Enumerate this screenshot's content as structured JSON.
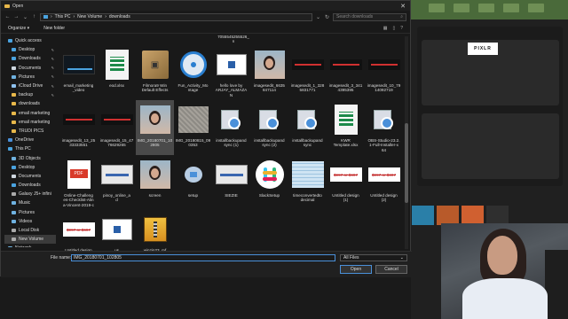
{
  "window": {
    "title": "Open"
  },
  "address": {
    "path": [
      "This PC",
      "New Volume",
      "downloads"
    ],
    "search_placeholder": "Search downloads"
  },
  "toolbar": {
    "organize": "Organize ▾",
    "new_folder": "New folder"
  },
  "sidebar": {
    "items": [
      {
        "label": "Quick access",
        "icon": "star-icon",
        "color": "#4aa3e0",
        "sub": false,
        "pin": false,
        "sel": false
      },
      {
        "label": "Desktop",
        "icon": "desktop-icon",
        "color": "#4aa3e0",
        "sub": true,
        "pin": true,
        "sel": false
      },
      {
        "label": "Downloads",
        "icon": "downloads-icon",
        "color": "#4aa3e0",
        "sub": true,
        "pin": true,
        "sel": false
      },
      {
        "label": "Documents",
        "icon": "documents-icon",
        "color": "#cfd8e0",
        "sub": true,
        "pin": true,
        "sel": false
      },
      {
        "label": "Pictures",
        "icon": "pictures-icon",
        "color": "#6fb2e0",
        "sub": true,
        "pin": true,
        "sel": false
      },
      {
        "label": "iCloud Drive",
        "icon": "cloud-icon",
        "color": "#8fc2f0",
        "sub": true,
        "pin": true,
        "sel": false
      },
      {
        "label": "backup",
        "icon": "folder-icon",
        "color": "#e8b84a",
        "sub": true,
        "pin": true,
        "sel": false
      },
      {
        "label": "downloads",
        "icon": "folder-icon",
        "color": "#e8b84a",
        "sub": true,
        "pin": false,
        "sel": false
      },
      {
        "label": "email marketing",
        "icon": "folder-icon",
        "color": "#e8b84a",
        "sub": true,
        "pin": false,
        "sel": false
      },
      {
        "label": "email marketing",
        "icon": "folder-icon",
        "color": "#e8b84a",
        "sub": true,
        "pin": false,
        "sel": false
      },
      {
        "label": "TRUDI PICS",
        "icon": "folder-icon",
        "color": "#e8b84a",
        "sub": true,
        "pin": false,
        "sel": false
      },
      {
        "label": "OneDrive",
        "icon": "onedrive-icon",
        "color": "#4a90d9",
        "sub": false,
        "pin": false,
        "sel": false
      },
      {
        "label": "This PC",
        "icon": "computer-icon",
        "color": "#4aa3e0",
        "sub": false,
        "pin": false,
        "sel": false
      },
      {
        "label": "3D Objects",
        "icon": "cube-icon",
        "color": "#6fb2e0",
        "sub": true,
        "pin": false,
        "sel": false
      },
      {
        "label": "Desktop",
        "icon": "desktop-icon",
        "color": "#4aa3e0",
        "sub": true,
        "pin": false,
        "sel": false
      },
      {
        "label": "Documents",
        "icon": "documents-icon",
        "color": "#cfd8e0",
        "sub": true,
        "pin": false,
        "sel": false
      },
      {
        "label": "Downloads",
        "icon": "downloads-icon",
        "color": "#4aa3e0",
        "sub": true,
        "pin": false,
        "sel": false
      },
      {
        "label": "Galaxy J5+ infini",
        "icon": "phone-icon",
        "color": "#aaaaaa",
        "sub": true,
        "pin": false,
        "sel": false
      },
      {
        "label": "Music",
        "icon": "music-icon",
        "color": "#6fb2e0",
        "sub": true,
        "pin": false,
        "sel": false
      },
      {
        "label": "Pictures",
        "icon": "pictures-icon",
        "color": "#6fb2e0",
        "sub": true,
        "pin": false,
        "sel": false
      },
      {
        "label": "Videos",
        "icon": "videos-icon",
        "color": "#6fb2e0",
        "sub": true,
        "pin": false,
        "sel": false
      },
      {
        "label": "Local Disk",
        "icon": "drive-icon",
        "color": "#aaaaaa",
        "sub": true,
        "pin": false,
        "sel": false
      },
      {
        "label": "New Volume",
        "icon": "drive-icon",
        "color": "#aaaaaa",
        "sub": true,
        "pin": false,
        "sel": true
      },
      {
        "label": "Network",
        "icon": "network-icon",
        "color": "#6fb2e0",
        "sub": false,
        "pin": false,
        "sel": false
      }
    ]
  },
  "top_fragment": "7055545255526_\nn",
  "files": [
    {
      "label": "email_marketing\n_video",
      "kind": "video",
      "sel": false
    },
    {
      "label": "eod.xlsx",
      "kind": "sheet",
      "sel": false
    },
    {
      "label": "Filmora9 Win\nDefault Effects",
      "kind": "box",
      "sel": false
    },
    {
      "label": "Fun_Activity_Mo\nntage",
      "kind": "disc",
      "sel": false
    },
    {
      "label": "hello love by\nARJAY_ALMAZA\nN",
      "kind": "doc",
      "sel": false
    },
    {
      "label": "imagesedit_6635\n847114",
      "kind": "photo",
      "sel": false
    },
    {
      "label": "imagesedit_1_328\n5831771",
      "kind": "red",
      "sel": false
    },
    {
      "label": "imagesedit_3_341\n4395395",
      "kind": "red",
      "sel": false
    },
    {
      "label": "imagesedit_10_79\n14092719",
      "kind": "red",
      "sel": false
    },
    {
      "label": "imagesedit_13_25\n33333551",
      "kind": "red",
      "sel": false
    },
    {
      "label": "imagesedit_15_47\n76629265",
      "kind": "red",
      "sel": false
    },
    {
      "label": "IMG_20180701_10\n2805",
      "kind": "photo",
      "sel": true
    },
    {
      "label": "IMG_20180815_09\n0353",
      "kind": "grey",
      "sel": false
    },
    {
      "label": "installbackupand\nsync (1)",
      "kind": "installer",
      "sel": false
    },
    {
      "label": "installbackupand\nsync (2)",
      "kind": "installer",
      "sel": false
    },
    {
      "label": "installbackupand\nsync",
      "kind": "installer",
      "sel": false
    },
    {
      "label": "KWR\nTemplate.xlsx",
      "kind": "sheet",
      "sel": false
    },
    {
      "label": "OBS-Studio-23.2.\n1-Full-Installer-x\n64",
      "kind": "installer",
      "sel": false
    },
    {
      "label": "Online-Challeng\nes-Checklist-Alin\na-Vincent-2019-c\nopy",
      "kind": "pdf",
      "sel": false
    },
    {
      "label": "pinoy_online_a\nd",
      "kind": "banner",
      "sel": false
    },
    {
      "label": "screen",
      "kind": "photo",
      "sel": false
    },
    {
      "label": "setup",
      "kind": "setup",
      "sel": false
    },
    {
      "label": "SIEZIE",
      "kind": "banner",
      "sel": false
    },
    {
      "label": "SlackSetup",
      "kind": "slack",
      "sel": false
    },
    {
      "label": "timeconvertedto\ndecimal",
      "kind": "table",
      "sel": false
    },
    {
      "label": "Untitled design\n(1)",
      "kind": "price",
      "sel": false
    },
    {
      "label": "Untitled design\n(2)",
      "kind": "price",
      "sel": false
    },
    {
      "label": "Untitled design",
      "kind": "price",
      "sel": false
    },
    {
      "label": "us",
      "kind": "doc",
      "sel": false
    },
    {
      "label": "winzip23_mf",
      "kind": "zip",
      "sel": false
    }
  ],
  "price_text": "$997 or $697",
  "bottom": {
    "file_name_label": "File name:",
    "file_name_value": "IMG_20180701_102805",
    "filter": "All Files",
    "open": "Open",
    "cancel": "Cancel"
  },
  "background": {
    "logo": "PIXLR"
  }
}
